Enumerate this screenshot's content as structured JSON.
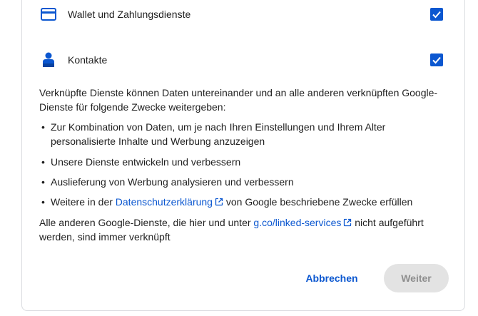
{
  "services": [
    {
      "label": "Wallet und Zahlungsdienste",
      "icon": "credit-card-icon",
      "checked": true
    },
    {
      "label": "Kontakte",
      "icon": "person-icon",
      "checked": true
    }
  ],
  "info": {
    "intro": "Verknüpfte Dienste können Daten untereinander und an alle anderen verknüpften Google-Dienste für folgende Zwecke weitergeben:",
    "bullets": [
      "Zur Kombination von Daten, um je nach Ihren Einstellungen und Ihrem Alter personalisierte Inhalte und Werbung anzuzeigen",
      "Unsere Dienste entwickeln und verbessern",
      "Auslieferung von Werbung analysieren und verbessern"
    ],
    "bullet4_before": "Weitere in der ",
    "bullet4_link": "Datenschutzerklärung",
    "bullet4_after": " von Google beschriebene Zwecke erfüllen",
    "footer_before": "Alle anderen Google-Dienste, die hier und unter ",
    "footer_link": "g.co/linked-services",
    "footer_after": " nicht aufgeführt werden, sind immer verknüpft"
  },
  "actions": {
    "cancel_label": "Abbrechen",
    "next_label": "Weiter"
  },
  "colors": {
    "accent": "#0b57d0",
    "disabled_bg": "#e3e3e3",
    "disabled_text": "#8e8e8e"
  }
}
